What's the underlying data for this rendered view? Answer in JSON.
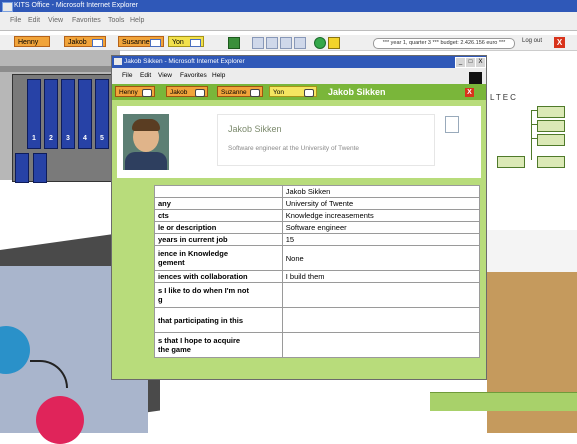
{
  "background_window": {
    "title": "KITS Office - Microsoft Internet Explorer",
    "menu": [
      "File",
      "Edit",
      "View",
      "Favorites",
      "Tools",
      "Help"
    ],
    "player_tabs": [
      "Henny",
      "Jakob",
      "Susanne",
      "Yon"
    ],
    "status_text": "*** year 1, quarter 3 *** budget: 2.426.156 euro ***",
    "logout_label": "Log out",
    "close_glyph": "X",
    "binder_numbers": [
      "1",
      "2",
      "3",
      "4",
      "5"
    ],
    "diagram_label": "LTEC"
  },
  "popup": {
    "title": "Jakob Sikken - Microsoft Internet Explorer",
    "menu": [
      "File",
      "Edit",
      "View",
      "Favorites",
      "Help"
    ],
    "window_buttons": [
      "_",
      "□",
      "X"
    ],
    "tabs": [
      "Henny",
      "Jakob",
      "Suzanne",
      "Yon"
    ],
    "header_name": "Jakob Sikken",
    "close_glyph": "X",
    "profile": {
      "name": "Jakob Sikken",
      "subtitle": "Software engineer at the University of Twente"
    },
    "table": {
      "rows": [
        {
          "label": "",
          "value": "Jakob Sikken"
        },
        {
          "label": "any",
          "value": "University of Twente"
        },
        {
          "label": "cts",
          "value": "Knowledge increasements"
        },
        {
          "label": "le or description",
          "value": "Software engineer"
        },
        {
          "label": "years in current job",
          "value": "15"
        },
        {
          "label": "ience in Knowledge\ngement",
          "value": "None"
        },
        {
          "label": "iences with collaboration",
          "value": "I build them"
        },
        {
          "label": "s I like to do when I'm not\ng",
          "value": ""
        },
        {
          "label": "that participating in this",
          "value": ""
        },
        {
          "label": "s that I hope to acquire\nthe game",
          "value": ""
        }
      ]
    }
  }
}
